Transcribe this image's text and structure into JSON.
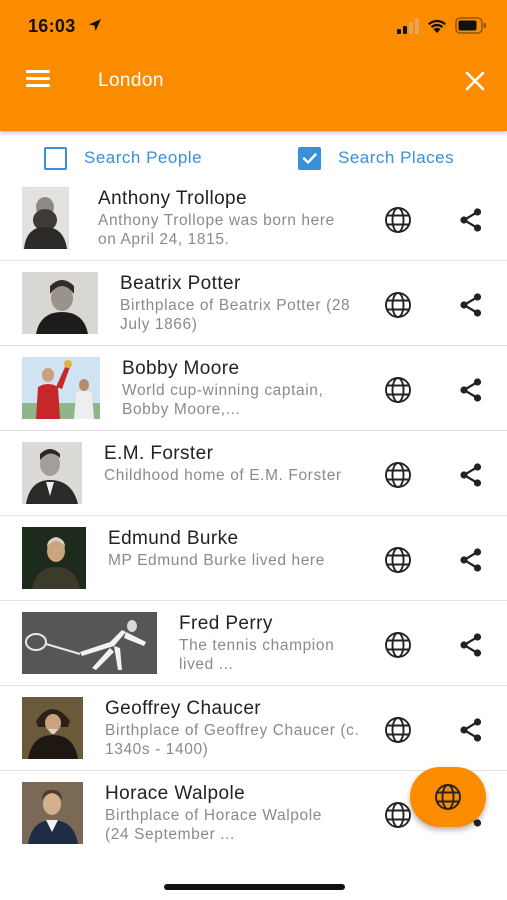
{
  "status_bar": {
    "time": "16:03"
  },
  "header": {
    "title": "London",
    "menu_icon": "hamburger-menu-icon",
    "close_icon": "close-icon",
    "color": "#fb8c00"
  },
  "filters": {
    "people": {
      "label": "Search People",
      "checked": false
    },
    "places": {
      "label": "Search Places",
      "checked": true
    },
    "color": "#3a8fd9"
  },
  "places": [
    {
      "title": "Anthony Trollope",
      "description": "Anthony Trollope was born here on April 24, 1815."
    },
    {
      "title": "Beatrix Potter",
      "description": "Birthplace of Beatrix Potter (28 July 1866)"
    },
    {
      "title": "Bobby Moore",
      "description": "World cup-winning captain, Bobby Moore,..."
    },
    {
      "title": "E.M. Forster",
      "description": "Childhood home of E.M. Forster"
    },
    {
      "title": "Edmund Burke",
      "description": "MP Edmund Burke lived here"
    },
    {
      "title": "Fred Perry",
      "description": "The tennis champion lived ..."
    },
    {
      "title": "Geoffrey Chaucer",
      "description": "Birthplace of Geoffrey Chaucer (c. 1340s - 1400)"
    },
    {
      "title": "Horace Walpole",
      "description": "Birthplace of Horace Walpole (24 September ..."
    }
  ],
  "row_icons": {
    "map": "globe-icon",
    "share": "share-icon"
  },
  "fab": {
    "icon": "globe-icon"
  }
}
